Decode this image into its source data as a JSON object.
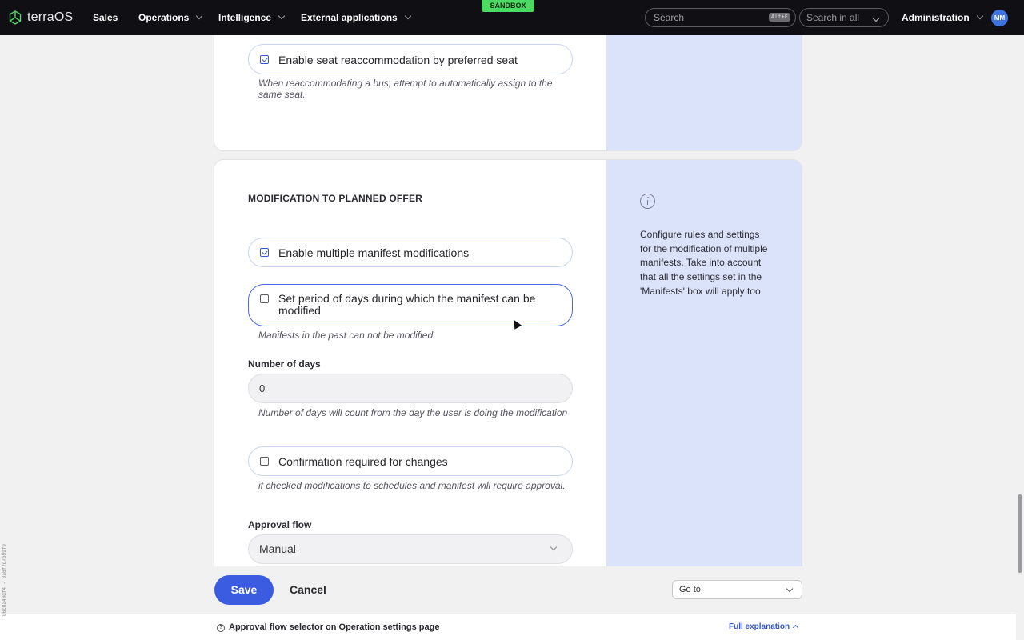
{
  "topbar": {
    "logo_text": "terraOS",
    "nav": [
      {
        "label": "Sales"
      },
      {
        "label": "Operations"
      },
      {
        "label": "Intelligence"
      },
      {
        "label": "External applications"
      }
    ],
    "sandbox_badge": "SANDBOX",
    "search_placeholder": "Search",
    "search_shortcut": "Alt+F",
    "search_scope": "Search in all",
    "admin_label": "Administration",
    "user_initials": "MM"
  },
  "seat_section": {
    "reaccommodation_label": "Enable seat reaccommodation by preferred seat",
    "reaccommodation_checked": true,
    "reaccommodation_help": "When reaccommodating a bus, attempt to automatically assign to the same seat."
  },
  "modification_section": {
    "title": "MODIFICATION TO PLANNED OFFER",
    "multiple_manifest_label": "Enable multiple manifest modifications",
    "multiple_manifest_checked": true,
    "period_label": "Set period of days during which the manifest can be modified",
    "period_checked": false,
    "period_help": "Manifests in the past can not be modified.",
    "days_label": "Number of days",
    "days_value": "0",
    "days_help": "Number of days will count from the day the user is doing the modification",
    "confirmation_label": "Confirmation required for changes",
    "confirmation_checked": false,
    "confirmation_help": "if checked modifications to schedules and manifest will require approval.",
    "approval_label": "Approval flow",
    "approval_value": "Manual",
    "info_text": "Configure rules and settings for the modification of multiple manifests. Take into account that all the settings set in the 'Manifests' box will apply too"
  },
  "actions": {
    "save": "Save",
    "cancel": "Cancel",
    "goto": "Go to"
  },
  "helpbar": {
    "title": "Approval flow selector on Operation settings page",
    "full_explanation": "Full explanation"
  },
  "version_id": "06c0240df4 - 0a6f7d7b99f9"
}
